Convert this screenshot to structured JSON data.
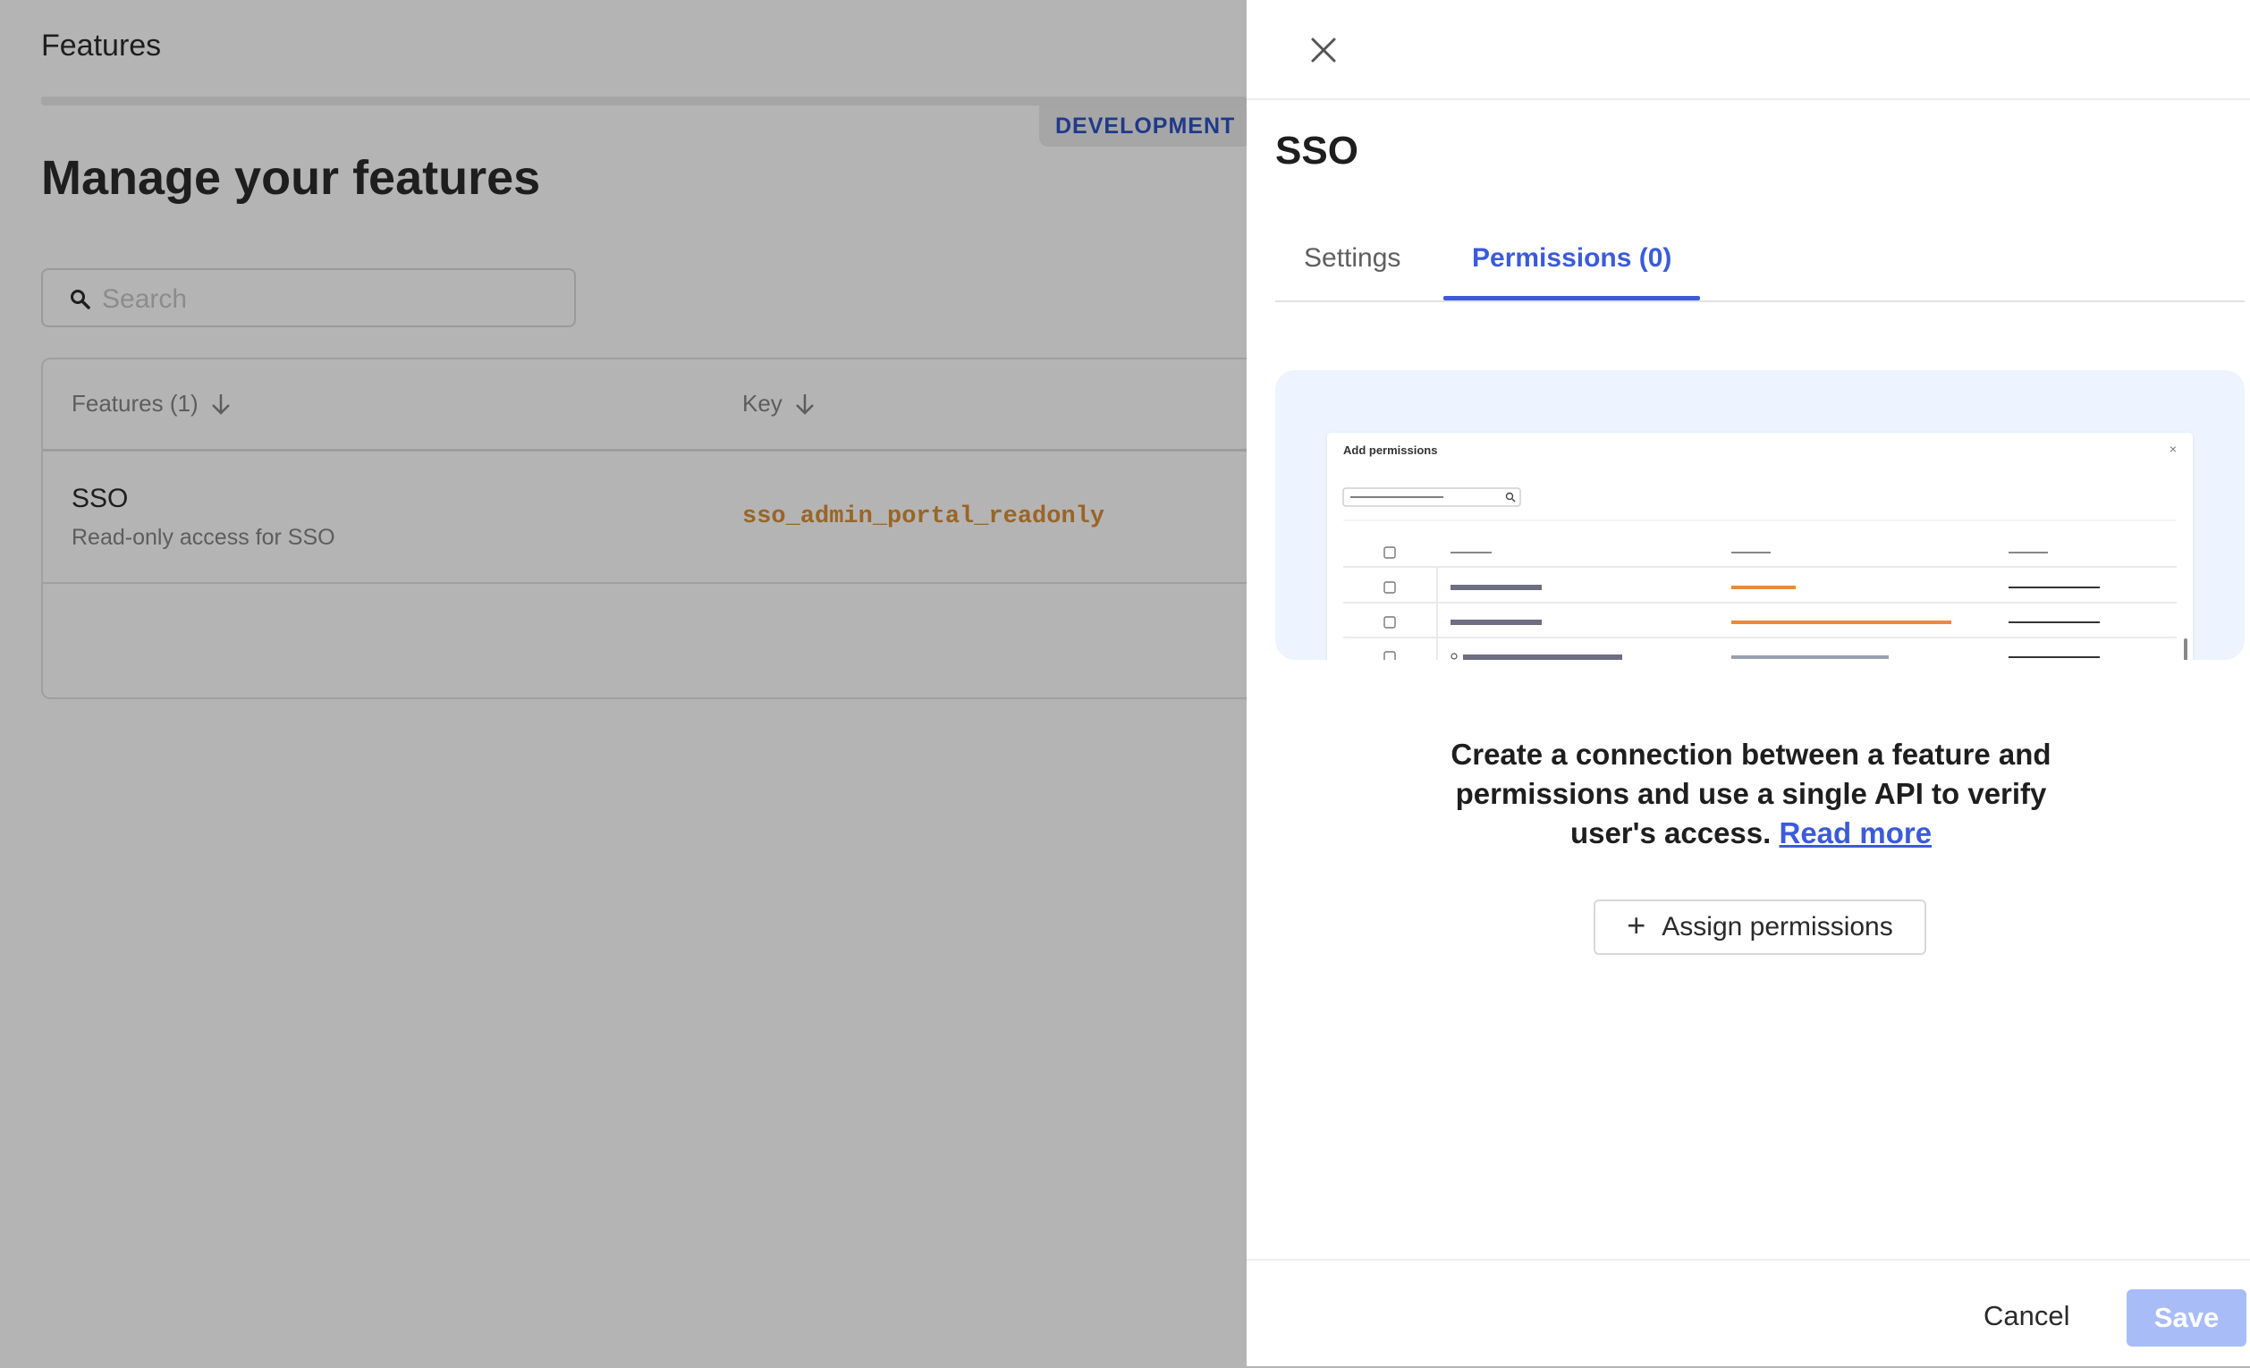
{
  "background": {
    "topbar_title": "Features",
    "environment_badge": "DEVELOPMENT",
    "page_title": "Manage your features",
    "search": {
      "placeholder": "Search",
      "value": ""
    },
    "table": {
      "columns": [
        {
          "label": "Features (1)",
          "sort": "desc"
        },
        {
          "label": "Key",
          "sort": "desc"
        }
      ],
      "rows": [
        {
          "name": "SSO",
          "description": "Read-only access for SSO",
          "key": "sso_admin_portal_readonly"
        }
      ]
    }
  },
  "panel": {
    "title": "SSO",
    "tabs": [
      {
        "label": "Settings",
        "active": false
      },
      {
        "label": "Permissions (0)",
        "active": true
      }
    ],
    "illustration": {
      "title": "Add permissions"
    },
    "empty_state": {
      "text": "Create a connection between a feature and permissions and use a single API to verify user's access.",
      "link_label": "Read more"
    },
    "assign_button": "Assign permissions",
    "footer": {
      "cancel_label": "Cancel",
      "save_label": "Save"
    }
  },
  "colors": {
    "accent": "#3b5bdb",
    "key_text": "#9a6526",
    "save_disabled": "#a8bdf7",
    "overlay": "#b4b4b4"
  }
}
